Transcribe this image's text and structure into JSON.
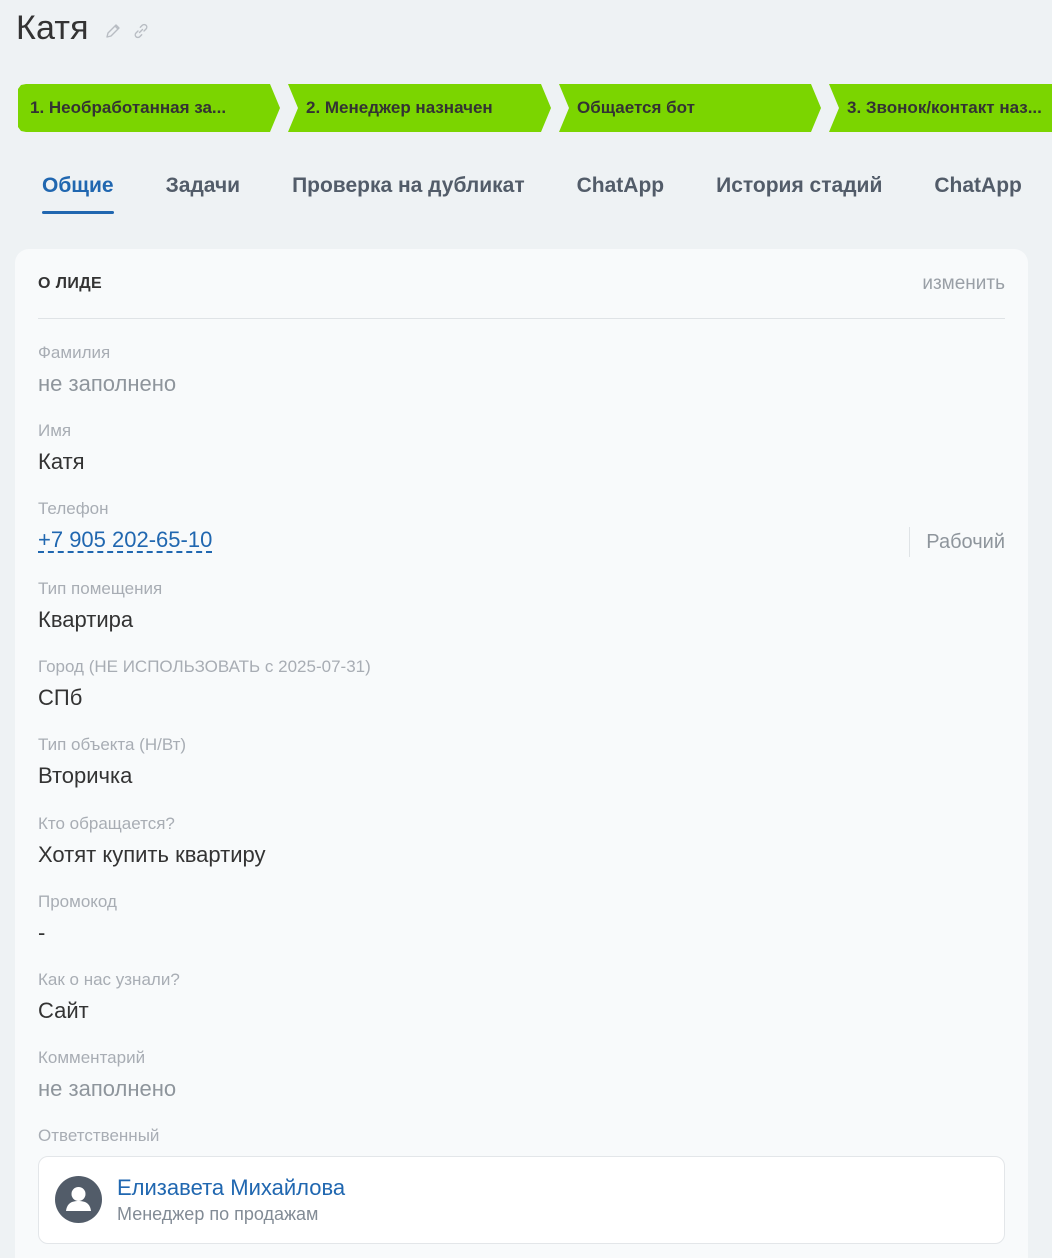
{
  "lead": {
    "title": "Катя"
  },
  "stages": [
    "1. Необработанная за...",
    "2. Менеджер назначен",
    "Общается бот",
    "3. Звонок/контакт наз..."
  ],
  "tabs": [
    "Общие",
    "Задачи",
    "Проверка на дубликат",
    "ChatApp",
    "История стадий",
    "ChatApp"
  ],
  "card": {
    "title": "О ЛИДЕ",
    "edit_label": "изменить"
  },
  "fields": {
    "lastname": {
      "label": "Фамилия",
      "value": "не заполнено"
    },
    "name": {
      "label": "Имя",
      "value": "Катя"
    },
    "phone": {
      "label": "Телефон",
      "value": "+7 905 202-65-10",
      "type": "Рабочий"
    },
    "room_type": {
      "label": "Тип помещения",
      "value": "Квартира"
    },
    "city": {
      "label": "Город (НЕ ИСПОЛЬЗОВАТЬ с 2025-07-31)",
      "value": "СПб"
    },
    "object_type": {
      "label": "Тип объекта (Н/Вт)",
      "value": "Вторичка"
    },
    "who": {
      "label": "Кто обращается?",
      "value": "Хотят купить квартиру"
    },
    "promo": {
      "label": "Промокод",
      "value": "-"
    },
    "source": {
      "label": "Как о нас узнали?",
      "value": "Сайт"
    },
    "comment": {
      "label": "Комментарий",
      "value": "не заполнено"
    },
    "responsible": {
      "label": "Ответственный",
      "name": "Елизавета Михайлова",
      "role": "Менеджер по продажам"
    }
  },
  "colors": {
    "stage_green": "#7bd500",
    "link_blue": "#2067b0",
    "background": "#eef2f4"
  }
}
